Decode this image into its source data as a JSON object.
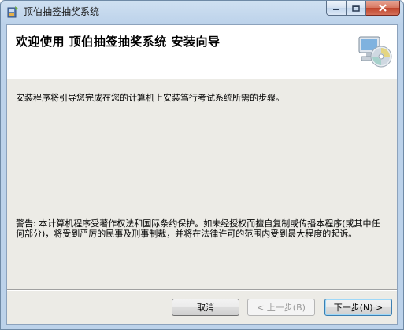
{
  "window": {
    "title": "顶伯抽签抽奖系统"
  },
  "banner": {
    "title": "欢迎使用  顶伯抽签抽奖系统  安装向导"
  },
  "content": {
    "intro": "安装程序将引导您完成在您的计算机上安装笃行考试系统所需的步骤。",
    "warning": "警告: 本计算机程序受著作权法和国际条约保护。如未经授权而擅自复制或传播本程序(或其中任何部分)，将受到严厉的民事及刑事制裁，并将在法律许可的范围内受到最大程度的起诉。"
  },
  "buttons": {
    "cancel": "取消",
    "back": "< 上一步(B)",
    "next": "下一步(N) >"
  },
  "colors": {
    "titlebar": "#bcd2ea",
    "client": "#ecebe6",
    "close": "#c0442b"
  }
}
